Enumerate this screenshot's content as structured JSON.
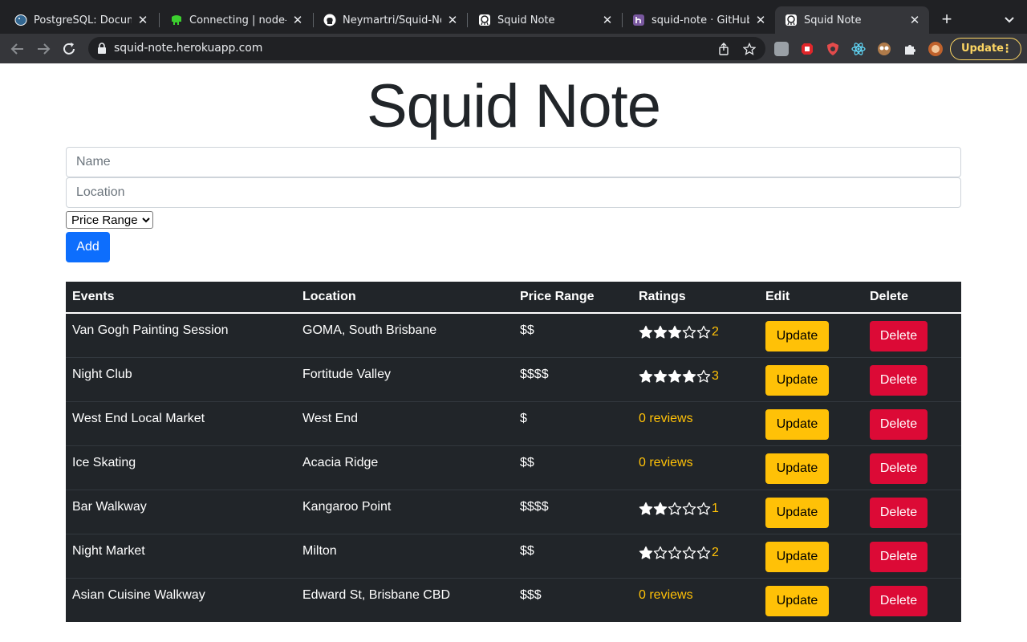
{
  "browser": {
    "tabs": [
      {
        "title": "PostgreSQL: Documen",
        "icon": "postgresql-elephant-icon",
        "active": false
      },
      {
        "title": "Connecting | node-po",
        "icon": "node-postgres-elephant-icon",
        "active": false
      },
      {
        "title": "Neymartri/Squid-Note",
        "icon": "github-icon",
        "active": false
      },
      {
        "title": "Squid Note",
        "icon": "squid-note-icon",
        "active": false
      },
      {
        "title": "squid-note · GitHub | H",
        "icon": "heroku-icon",
        "active": false
      },
      {
        "title": "Squid Note",
        "icon": "squid-note-icon",
        "active": true
      }
    ],
    "url": "squid-note.herokuapp.com",
    "update_label": "Update"
  },
  "app": {
    "title": "Squid Note",
    "form": {
      "name_placeholder": "Name",
      "location_placeholder": "Location",
      "price_select_value": "Price Range",
      "add_label": "Add"
    },
    "table": {
      "headers": {
        "events": "Events",
        "location": "Location",
        "price": "Price Range",
        "ratings": "Ratings",
        "edit": "Edit",
        "delete": "Delete"
      },
      "update_label": "Update",
      "delete_label": "Delete",
      "no_reviews_label": "0 reviews",
      "rows": [
        {
          "name": "Van Gogh Painting Session",
          "location": "GOMA, South Brisbane",
          "price": "$$",
          "stars": 3,
          "review_count": "2"
        },
        {
          "name": "Night Club",
          "location": "Fortitude Valley",
          "price": "$$$$",
          "stars": 4,
          "review_count": "3"
        },
        {
          "name": "West End Local Market",
          "location": "West End",
          "price": "$",
          "stars": 0,
          "review_count": null
        },
        {
          "name": "Ice Skating",
          "location": "Acacia Ridge",
          "price": "$$",
          "stars": 0,
          "review_count": null
        },
        {
          "name": "Bar Walkway",
          "location": "Kangaroo Point",
          "price": "$$$$",
          "stars": 2,
          "review_count": "1"
        },
        {
          "name": "Night Market",
          "location": "Milton",
          "price": "$$",
          "stars": 1,
          "review_count": "2"
        },
        {
          "name": "Asian Cuisine Walkway",
          "location": "Edward St, Brisbane CBD",
          "price": "$$$",
          "stars": 0,
          "review_count": null
        }
      ]
    }
  },
  "colors": {
    "primary": "#0d6efd",
    "warning": "#ffc107",
    "danger": "#dc0a36",
    "table_dark": "#212529"
  }
}
